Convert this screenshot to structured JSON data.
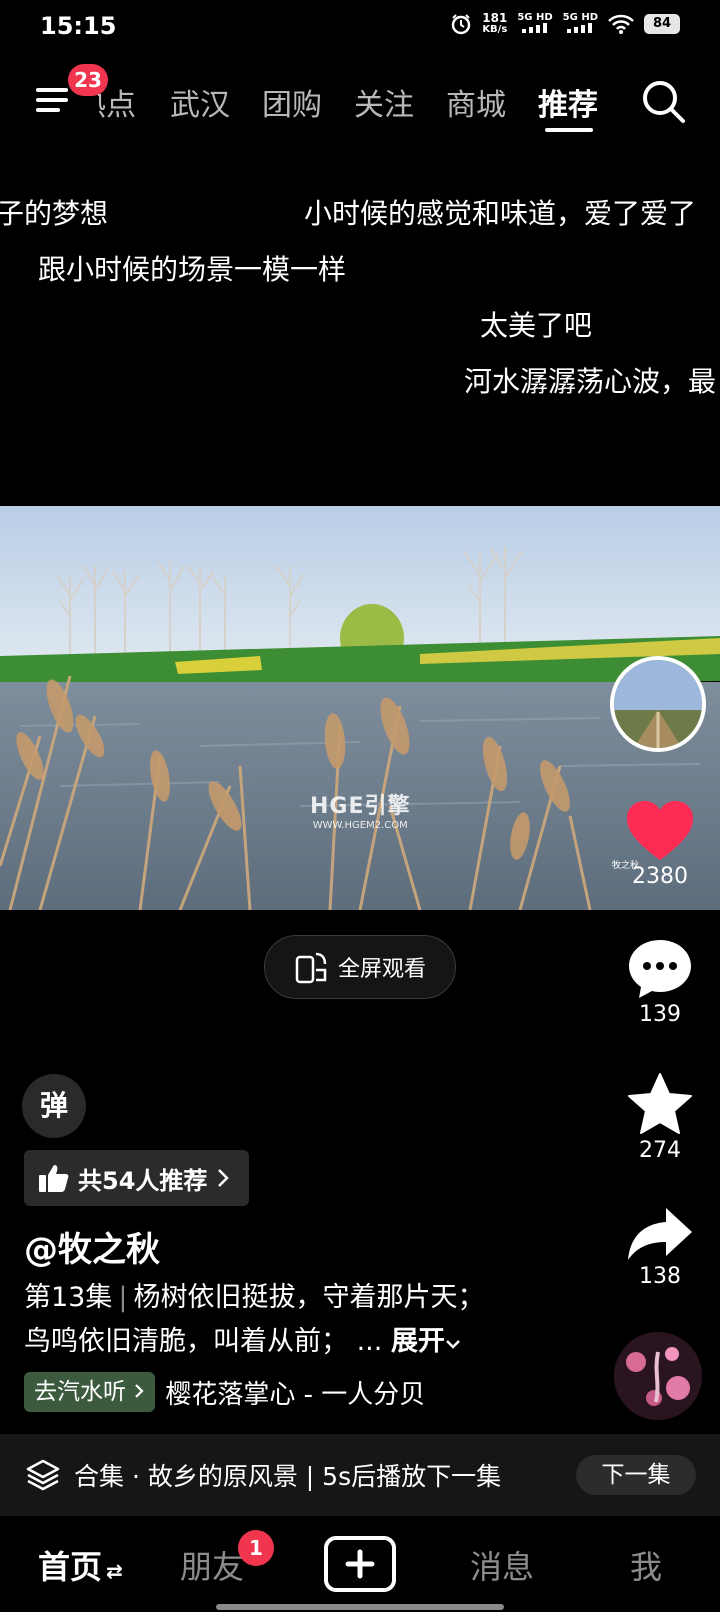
{
  "status_bar": {
    "time": "15:15",
    "speed_value": "181",
    "speed_unit": "KB/s",
    "net1": "5G HD",
    "net2": "5G HD",
    "battery": "84"
  },
  "top_nav": {
    "menu_badge": "23",
    "tabs": [
      "热点",
      "武汉",
      "团购",
      "关注",
      "商城",
      "推荐"
    ],
    "active_tab": "推荐"
  },
  "danmaku": [
    "子的梦想",
    "小时候的感觉和味道，爱了爱了",
    "跟小时候的场景一模一样",
    "太美了吧",
    "河水潺潺荡心波，最"
  ],
  "video": {
    "watermark_title": "HGE引擎",
    "watermark_url": "WWW.HGEM2.COM"
  },
  "rail": {
    "like_count": "2380",
    "like_label": "牧之秋",
    "comment_count": "139",
    "favorite_count": "274",
    "share_count": "138"
  },
  "fullscreen_label": "全屏观看",
  "danmu_toggle": "弹",
  "recommend_label": "共54人推荐",
  "author": "@牧之秋",
  "description": {
    "episode": "第13集",
    "line1": "杨树依旧挺拔，守着那片天；",
    "line2": "鸟鸣依旧清脆，叫着从前；",
    "ellipsis": "...",
    "expand": "展开"
  },
  "music": {
    "chip": "去汽水听",
    "title": "樱花落掌心 - 一人分贝"
  },
  "collection": {
    "text": "合集 · 故乡的原风景 | 5s后播放下一集",
    "next": "下一集"
  },
  "bottom_nav": {
    "home": "首页",
    "friends": "朋友",
    "friends_badge": "1",
    "messages": "消息",
    "me": "我"
  },
  "colors": {
    "badge": "#f0354f",
    "like": "#fe2c55",
    "music_chip": "#3c5a3e"
  }
}
